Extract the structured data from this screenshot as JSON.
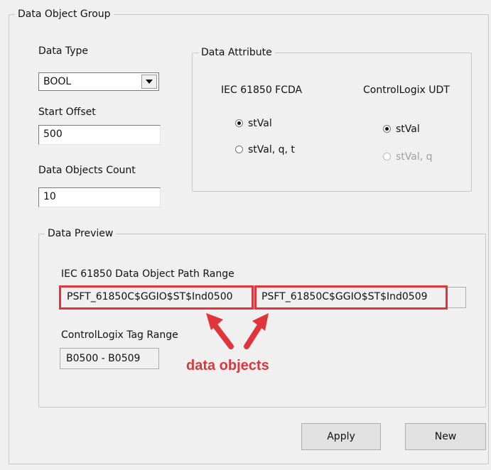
{
  "data_object_group": {
    "title": "Data Object Group",
    "data_type": {
      "label": "Data Type",
      "value": "BOOL"
    },
    "start_offset": {
      "label": "Start Offset",
      "value": "500"
    },
    "data_objects_count": {
      "label": "Data Objects Count",
      "value": "10"
    }
  },
  "data_attribute": {
    "title": "Data Attribute",
    "iec": {
      "header": "IEC 61850 FCDA",
      "options": [
        {
          "label": "stVal",
          "selected": true
        },
        {
          "label": "stVal, q, t",
          "selected": false
        }
      ]
    },
    "controllogix": {
      "header": "ControlLogix UDT",
      "options": [
        {
          "label": "stVal",
          "selected": true,
          "enabled": true
        },
        {
          "label": "stVal, q",
          "selected": false,
          "enabled": false
        }
      ]
    }
  },
  "data_preview": {
    "title": "Data Preview",
    "iec_path_label": "IEC 61850 Data Object Path Range",
    "iec_path_start": "PSFT_61850C$GGIO$ST$Ind0500",
    "iec_path_end": "PSFT_61850C$GGIO$ST$Ind0509",
    "tag_range_label": "ControlLogix Tag Range",
    "tag_range_value": "B0500 - B0509"
  },
  "annotation": {
    "text": "data objects",
    "color": "#e0353a"
  },
  "buttons": {
    "apply": "Apply",
    "new": "New"
  }
}
